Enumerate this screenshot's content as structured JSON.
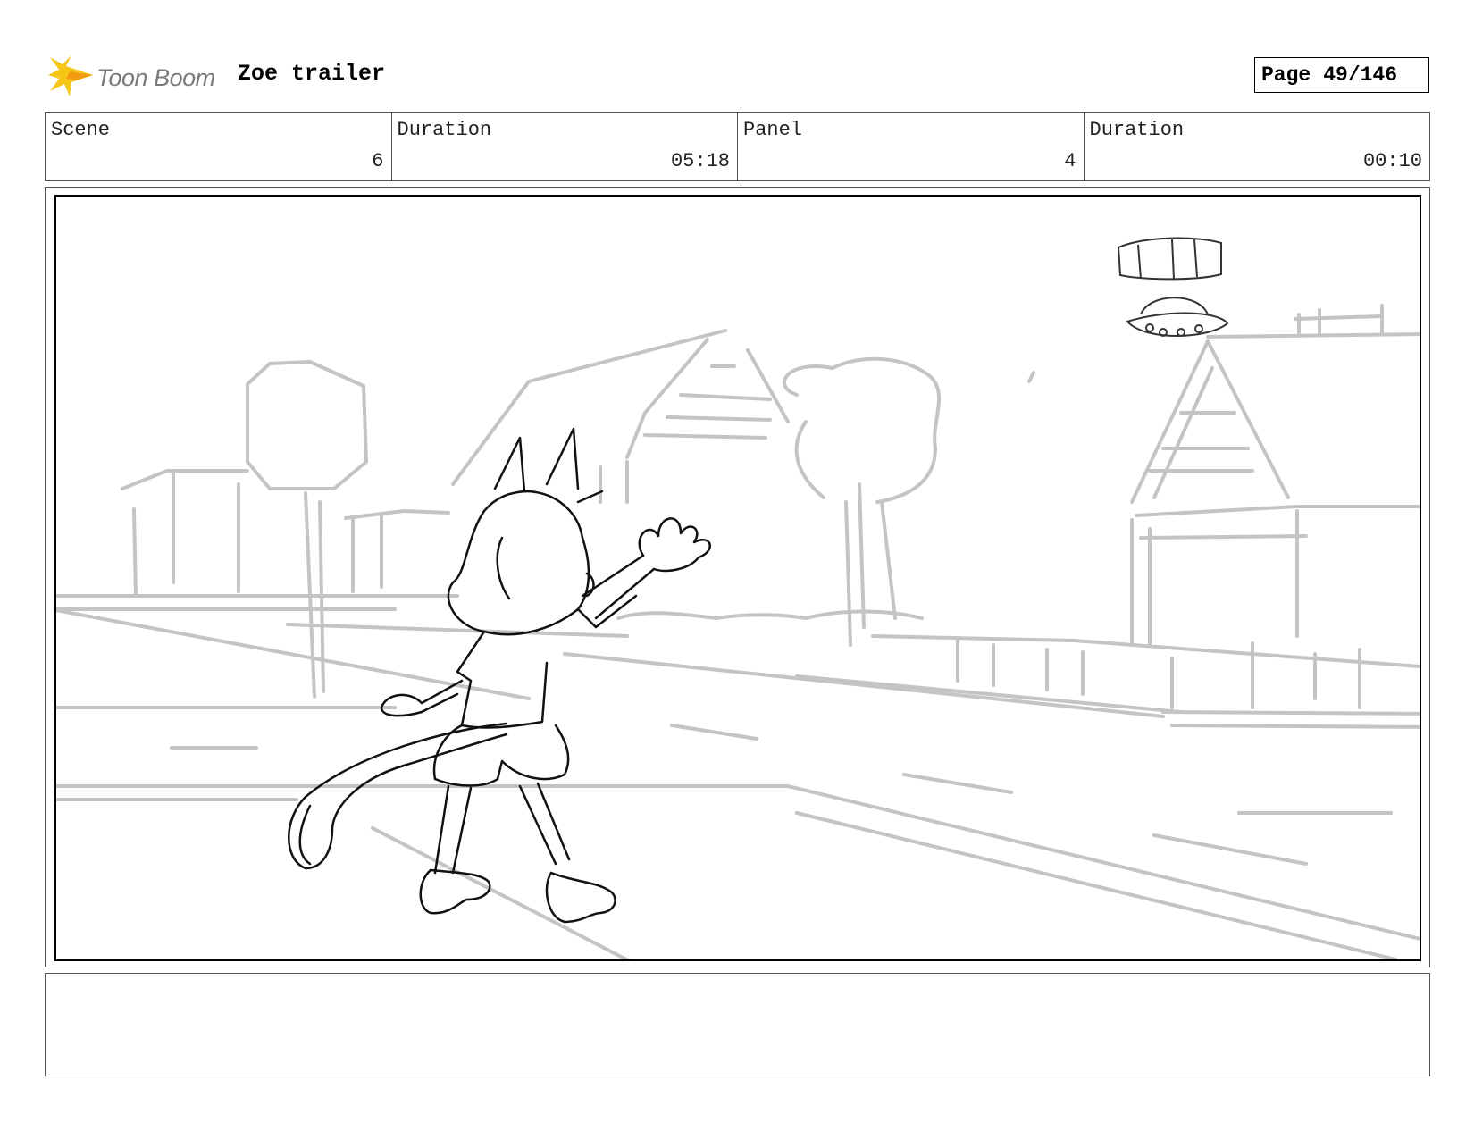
{
  "header": {
    "logo_text": "Toon Boom",
    "project_title": "Zoe trailer",
    "page_label": "Page",
    "page_value": "49/146"
  },
  "info": [
    {
      "label": "Scene",
      "value": "6"
    },
    {
      "label": "Duration",
      "value": "05:18"
    },
    {
      "label": "Panel",
      "value": "4"
    },
    {
      "label": "Duration",
      "value": "00:10"
    }
  ],
  "notes": {
    "text": ""
  },
  "colors": {
    "logo_yellow": "#f5c518",
    "logo_orange": "#f39c12",
    "sketch_gray": "#c4c4c4",
    "ink": "#111111"
  }
}
